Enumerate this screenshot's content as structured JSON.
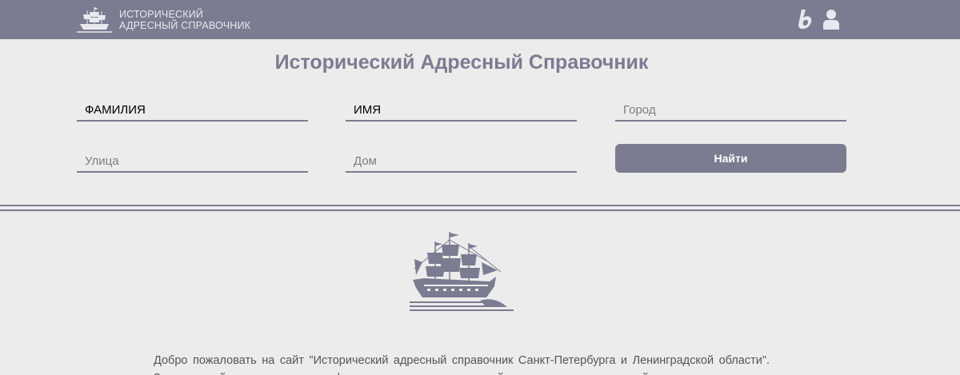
{
  "header": {
    "brand_line1": "ИСТОРИЧЕСКИЙ",
    "brand_line2": "АДРЕСНЫЙ СПРАВОЧНИК",
    "icons": [
      "ship-logo-icon",
      "b-logo-icon",
      "user-icon"
    ],
    "bar_color": "#7b7c91"
  },
  "page_title": "Исторический Адресный Справочник",
  "search": {
    "surname": {
      "value": "ФАМИЛИЯ",
      "placeholder": ""
    },
    "name": {
      "value": "ИМЯ",
      "placeholder": ""
    },
    "city": {
      "value": "",
      "placeholder": "Город"
    },
    "street": {
      "value": "",
      "placeholder": "Улица"
    },
    "house": {
      "value": "",
      "placeholder": "Дом"
    },
    "submit_label": "Найти"
  },
  "welcome_text": "Добро пожаловать на сайт \"Исторический адресный справочник Санкт-Петербурга и Ленинградской области\". Здесь вы найдете уникальную информацию о прошлом жителей города и его окрестностей, проследите за"
}
